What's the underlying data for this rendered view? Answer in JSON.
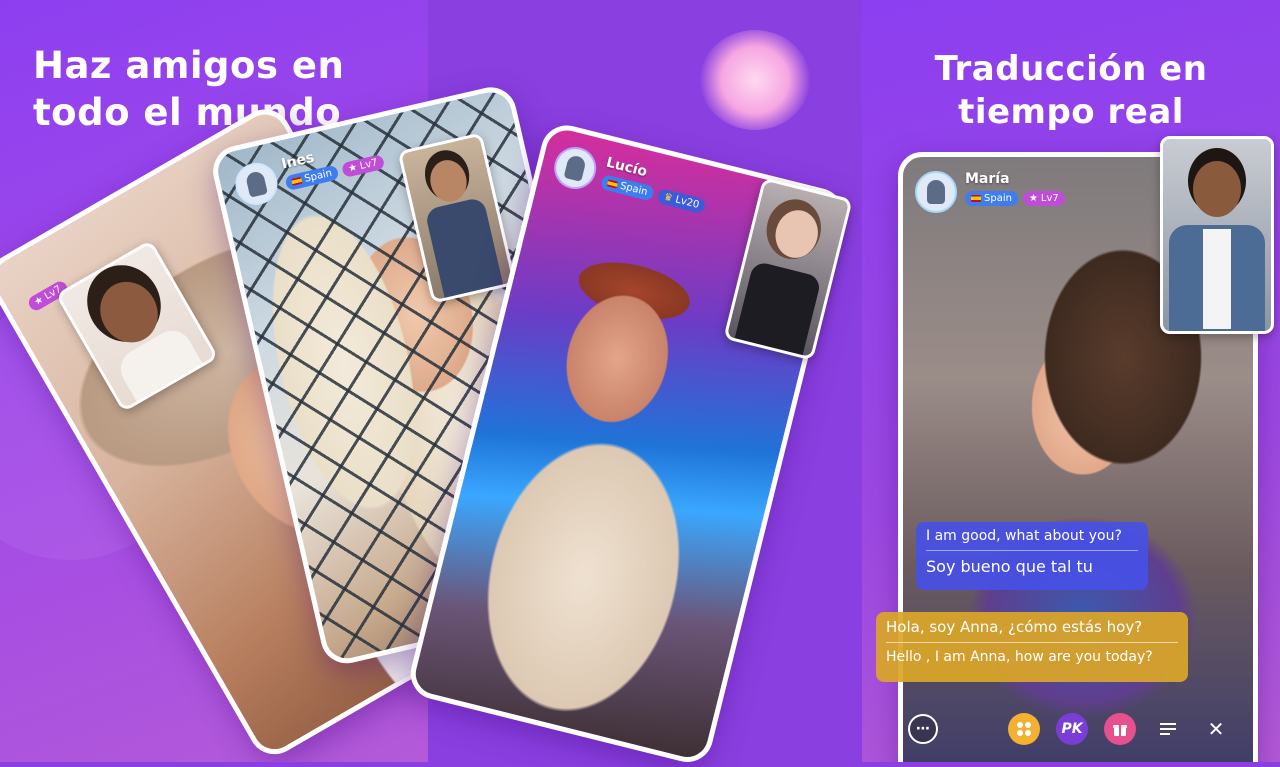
{
  "headlines": {
    "left": [
      "Haz amigos en",
      "todo el mundo"
    ],
    "right": [
      "Traducción en",
      "tiempo real"
    ]
  },
  "cards": {
    "card1": {
      "level": "Lv7"
    },
    "card2": {
      "name": "Ines",
      "country": "Spain",
      "level": "Lv7"
    },
    "card3": {
      "name": "Lucío",
      "country": "Spain",
      "level": "Lv20"
    },
    "card4": {
      "name": "María",
      "country": "Spain",
      "level": "Lv7",
      "chat": [
        {
          "translation": "I am good, what about you?",
          "original": "Soy bueno que tal tu"
        },
        {
          "original": "Hola, soy Anna, ¿cómo estás hoy?",
          "translation": "Hello , I am Anna, how are you today?"
        }
      ],
      "toolbar": {
        "pk_label": "PK",
        "icons": [
          "chat-icon",
          "apps-icon",
          "pk-icon",
          "gift-icon",
          "menu-icon",
          "close-icon"
        ]
      }
    }
  },
  "colors": {
    "background": "#8a3fe0",
    "chat_blue": "#4650e6",
    "chat_gold": "#daa628",
    "level_badge": "#c04dd8",
    "country_badge": "#3e7df0"
  }
}
